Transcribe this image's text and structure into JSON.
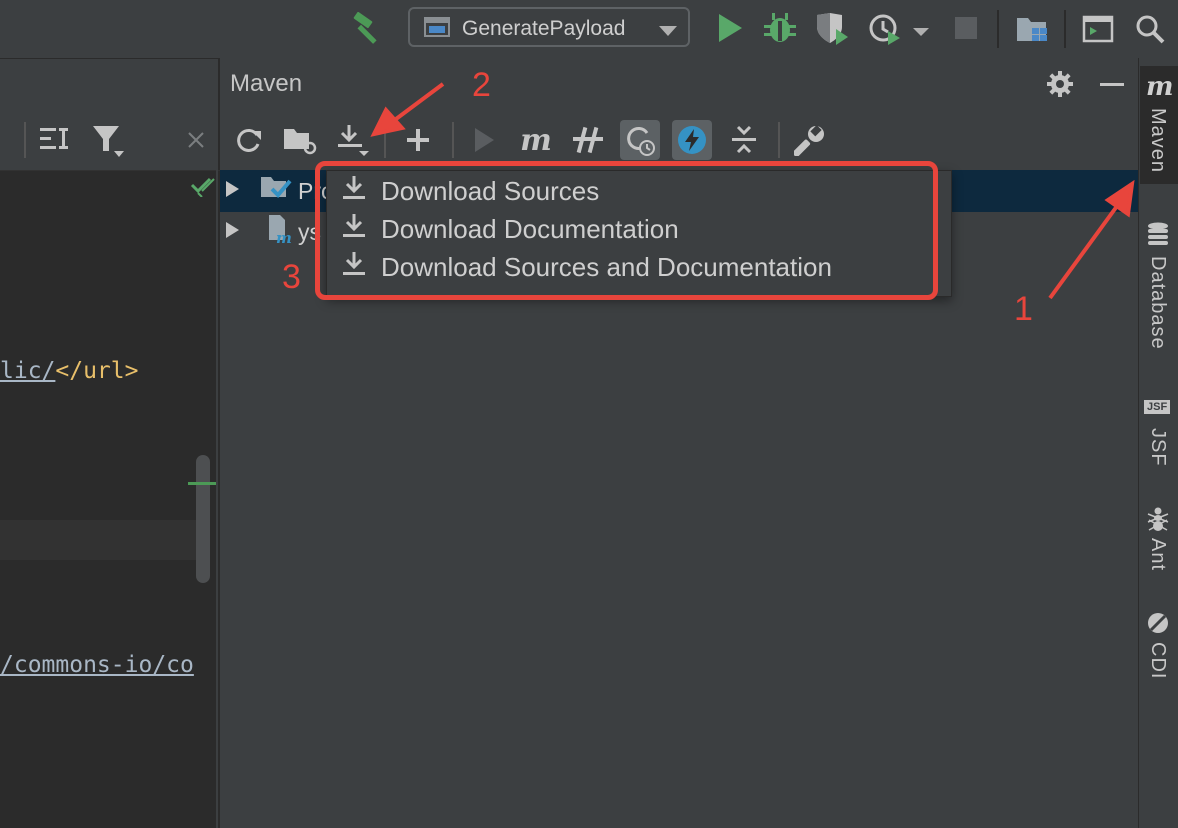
{
  "toolbar": {
    "run_config": "GeneratePayload",
    "colors": {
      "green": "#59a869",
      "build": "#4c9a56"
    }
  },
  "maven_panel": {
    "title": "Maven",
    "tree": {
      "row1_label": "Pro",
      "row2_label": "ys"
    }
  },
  "download_menu": {
    "items": [
      {
        "label": "Download Sources"
      },
      {
        "label": "Download Documentation"
      },
      {
        "label": "Download Sources and Documentation"
      }
    ]
  },
  "editor": {
    "line1_link": "lic/",
    "line1_tag": "</url>",
    "line2_link": "/commons-io/co"
  },
  "right_stripe": {
    "tabs": [
      "Maven",
      "Database",
      "JSF",
      "Ant",
      "CDI"
    ]
  },
  "annotations": {
    "n1": "1",
    "n2": "2",
    "n3": "3",
    "color": "#e8453c"
  }
}
